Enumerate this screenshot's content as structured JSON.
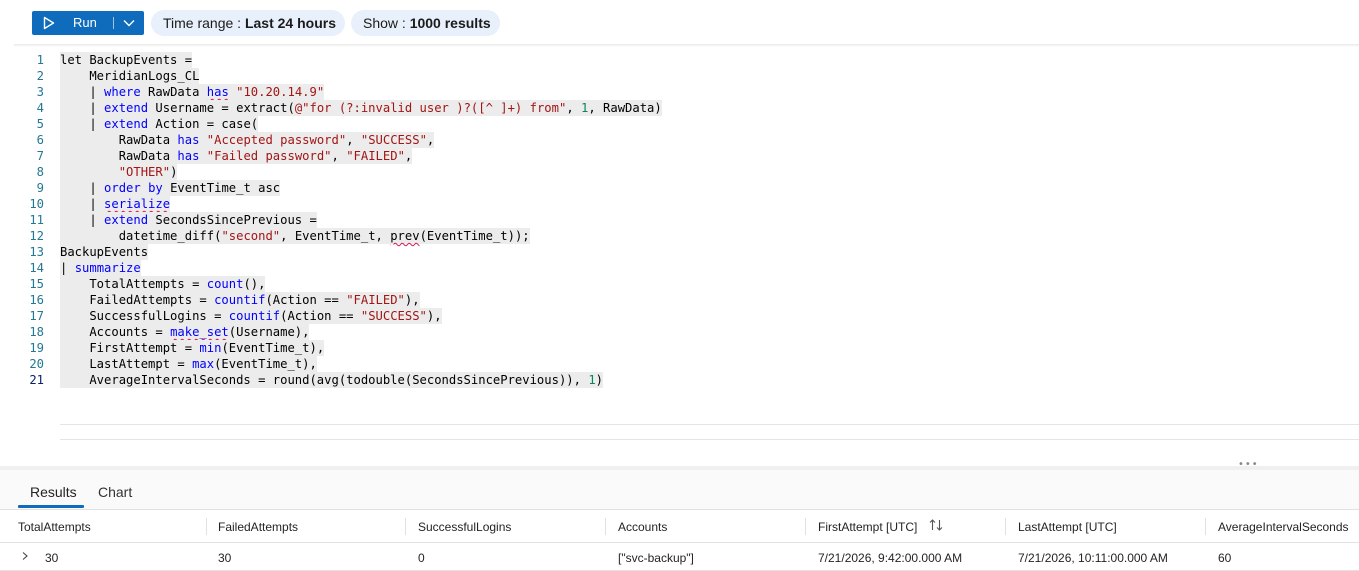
{
  "toolbar": {
    "run_label": "Run",
    "time_range_label": "Time range :",
    "time_range_value": "Last 24 hours",
    "show_label": "Show :",
    "show_value": "1000 results",
    "icons": {
      "run": "play-icon",
      "dropdown": "chevron-down-icon"
    }
  },
  "editor": {
    "line_numbers": [
      "1",
      "2",
      "3",
      "4",
      "5",
      "6",
      "7",
      "8",
      "9",
      "10",
      "11",
      "12",
      "13",
      "14",
      "15",
      "16",
      "17",
      "18",
      "19",
      "20",
      "21"
    ],
    "active_line": "21",
    "lines": [
      "let BackupEvents =",
      "    MeridianLogs_CL",
      "    | where RawData has \"10.20.14.9\"",
      "    | extend Username = extract(@\"for (?:invalid user )?([^ ]+) from\", 1, RawData)",
      "    | extend Action = case(",
      "        RawData has \"Accepted password\", \"SUCCESS\",",
      "        RawData has \"Failed password\", \"FAILED\",",
      "        \"OTHER\")",
      "    | order by EventTime_t asc",
      "    | serialize",
      "    | extend SecondsSincePrevious =",
      "        datetime_diff(\"second\", EventTime_t, prev(EventTime_t));",
      "BackupEvents",
      "| summarize",
      "    TotalAttempts = count(),",
      "    FailedAttempts = countif(Action == \"FAILED\"),",
      "    SuccessfulLogins = countif(Action == \"SUCCESS\"),",
      "    Accounts = make_set(Username),",
      "    FirstAttempt = min(EventTime_t),",
      "    LastAttempt = max(EventTime_t),",
      "    AverageIntervalSeconds = round(avg(todouble(SecondsSincePrevious)), 1)"
    ]
  },
  "results": {
    "tabs": [
      "Results",
      "Chart"
    ],
    "selected_tab": "Results",
    "columns": [
      "TotalAttempts",
      "FailedAttempts",
      "SuccessfulLogins",
      "Accounts",
      "FirstAttempt [UTC]",
      "LastAttempt [UTC]",
      "AverageIntervalSeconds"
    ],
    "rows": [
      [
        "30",
        "30",
        "0",
        "[\"svc-backup\"]",
        "7/21/2026, 9:42:00.000 AM",
        "7/21/2026, 10:11:00.000 AM",
        "60"
      ]
    ],
    "icons": {
      "sort": "sort-icon",
      "expand": "chevron-right-icon"
    }
  },
  "colors": {
    "accent": "#0f6cbd",
    "pill_bg": "#e8f0fb",
    "keyword": "#0000ff",
    "string": "#a31515",
    "number": "#098658",
    "line_number": "#237893"
  }
}
